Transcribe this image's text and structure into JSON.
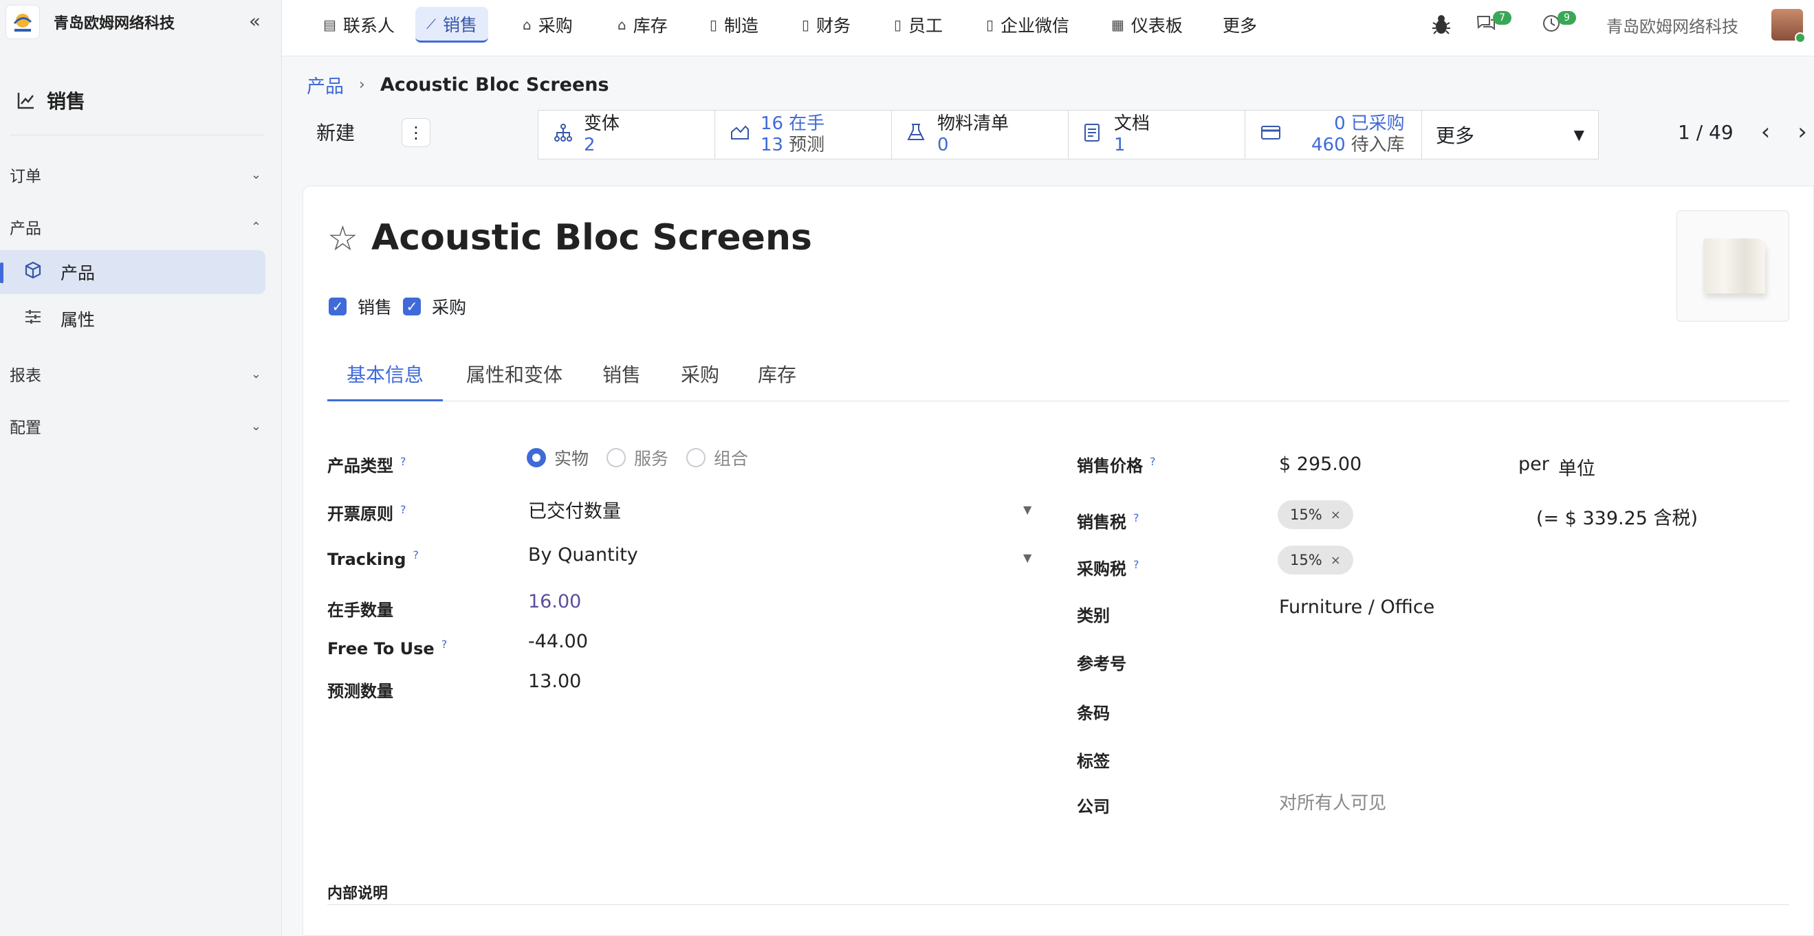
{
  "sidebar": {
    "brand_name": "青岛欧姆网络科技",
    "app_title": "销售",
    "sections": {
      "orders": "订单",
      "products": "产品",
      "reports": "报表",
      "config": "配置"
    },
    "items": {
      "products": "产品",
      "attributes": "属性"
    }
  },
  "topnav": {
    "items": [
      "联系人",
      "销售",
      "采购",
      "库存",
      "制造",
      "财务",
      "员工",
      "企业微信",
      "仪表板",
      "更多"
    ],
    "messages_count": "7",
    "activities_count": "9",
    "company": "青岛欧姆网络科技"
  },
  "breadcrumb": {
    "root": "产品",
    "current": "Acoustic Bloc Screens"
  },
  "controls": {
    "new_label": "新建",
    "pager": "1 / 49"
  },
  "smart_buttons": {
    "variants": {
      "label": "变体",
      "value": "2"
    },
    "stock": {
      "on_hand_value": "16",
      "on_hand_label": "在手",
      "forecast_value": "13",
      "forecast_label": "预测"
    },
    "bom": {
      "label": "物料清单",
      "value": "0"
    },
    "documents": {
      "label": "文档",
      "value": "1"
    },
    "purchase": {
      "purchased_value": "0",
      "purchased_label": "已采购",
      "incoming_value": "460",
      "incoming_label": "待入库"
    },
    "more": "更多"
  },
  "product": {
    "name": "Acoustic Bloc Screens",
    "can_be_sold": "销售",
    "can_be_purchased": "采购"
  },
  "tabs": [
    "基本信息",
    "属性和变体",
    "销售",
    "采购",
    "库存"
  ],
  "left_fields": {
    "product_type": {
      "label": "产品类型",
      "options": [
        "实物",
        "服务",
        "组合"
      ],
      "selected": "实物"
    },
    "invoice_policy": {
      "label": "开票原则",
      "value": "已交付数量"
    },
    "tracking": {
      "label": "Tracking",
      "value": "By Quantity"
    },
    "qty_on_hand": {
      "label": "在手数量",
      "value": "16.00"
    },
    "free_to_use": {
      "label": "Free To Use",
      "value": "-44.00"
    },
    "forecast_qty": {
      "label": "预测数量",
      "value": "13.00"
    }
  },
  "right_fields": {
    "sales_price": {
      "label": "销售价格",
      "value": "$ 295.00",
      "per": "per",
      "uom": "单位"
    },
    "sales_tax": {
      "label": "销售税",
      "tag": "15%",
      "incl": "(= $ 339.25 含税)"
    },
    "purchase_tax": {
      "label": "采购税",
      "tag": "15%"
    },
    "category": {
      "label": "类别",
      "value": "Furniture / Office"
    },
    "reference": {
      "label": "参考号"
    },
    "barcode": {
      "label": "条码"
    },
    "tags": {
      "label": "标签"
    },
    "company": {
      "label": "公司",
      "placeholder": "对所有人可见"
    }
  },
  "internal_notes": {
    "label": "内部说明"
  },
  "colors": {
    "accent": "#3f6ad8",
    "badge": "#3aa757"
  }
}
